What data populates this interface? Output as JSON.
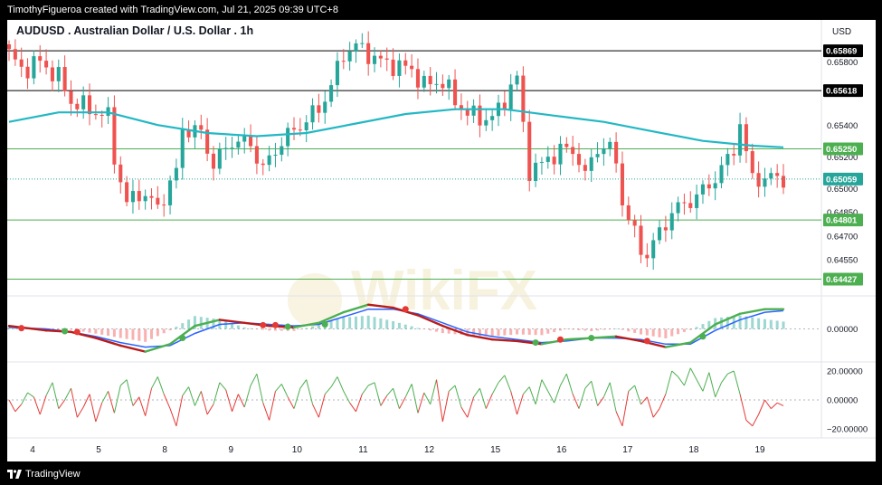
{
  "header": {
    "attribution": "TimothyFigueroa created with TradingView.com, Jul 21, 2025 09:39 UTC+8"
  },
  "footer": {
    "brand": "TradingView"
  },
  "watermark": {
    "text": "WikiFX"
  },
  "chart_data": {
    "type": "candlestick",
    "symbol_title": "AUDUSD . Australian Dollar / U.S. Dollar . 1h",
    "currency": "USD",
    "x_labels": [
      "4",
      "5",
      "8",
      "9",
      "10",
      "11",
      "12",
      "15",
      "16",
      "17",
      "18",
      "19"
    ],
    "price_axis": {
      "ylim": [
        0.6435,
        0.6595
      ],
      "ticks": [
        "0.65800",
        "0.65400",
        "0.65200",
        "0.65000",
        "0.64850",
        "0.64700",
        "0.64550"
      ]
    },
    "horizontal_levels": [
      {
        "value": 0.65869,
        "label": "0.65869",
        "color": "#000000"
      },
      {
        "value": 0.65618,
        "label": "0.65618",
        "color": "#000000"
      },
      {
        "value": 0.6525,
        "label": "0.65250",
        "color": "#4caf50"
      },
      {
        "value": 0.64801,
        "label": "0.64801",
        "color": "#4caf50"
      },
      {
        "value": 0.64427,
        "label": "0.64427",
        "color": "#4caf50"
      }
    ],
    "last_price": {
      "value": 0.65059,
      "label": "0.65059",
      "color": "#26a69a"
    },
    "price_path": [
      {
        "x": 0,
        "y": 0.6585
      },
      {
        "x": 2,
        "y": 0.6575
      },
      {
        "x": 5,
        "y": 0.658
      },
      {
        "x": 8,
        "y": 0.657
      },
      {
        "x": 10,
        "y": 0.6555
      },
      {
        "x": 13,
        "y": 0.655
      },
      {
        "x": 16,
        "y": 0.6545
      },
      {
        "x": 17,
        "y": 0.652
      },
      {
        "x": 19,
        "y": 0.649
      },
      {
        "x": 21,
        "y": 0.6498
      },
      {
        "x": 24,
        "y": 0.6488
      },
      {
        "x": 27,
        "y": 0.651
      },
      {
        "x": 28,
        "y": 0.6538
      },
      {
        "x": 31,
        "y": 0.6535
      },
      {
        "x": 33,
        "y": 0.6515
      },
      {
        "x": 36,
        "y": 0.653
      },
      {
        "x": 39,
        "y": 0.6528
      },
      {
        "x": 41,
        "y": 0.6512
      },
      {
        "x": 44,
        "y": 0.653
      },
      {
        "x": 47,
        "y": 0.654
      },
      {
        "x": 50,
        "y": 0.655
      },
      {
        "x": 52,
        "y": 0.6565
      },
      {
        "x": 54,
        "y": 0.6585
      },
      {
        "x": 56,
        "y": 0.659
      },
      {
        "x": 58,
        "y": 0.6585
      },
      {
        "x": 60,
        "y": 0.658
      },
      {
        "x": 62,
        "y": 0.6578
      },
      {
        "x": 65,
        "y": 0.6575
      },
      {
        "x": 67,
        "y": 0.6565
      },
      {
        "x": 70,
        "y": 0.6568
      },
      {
        "x": 72,
        "y": 0.6555
      },
      {
        "x": 75,
        "y": 0.6545
      },
      {
        "x": 77,
        "y": 0.6544
      },
      {
        "x": 79,
        "y": 0.6548
      },
      {
        "x": 81,
        "y": 0.6565
      },
      {
        "x": 82,
        "y": 0.657
      },
      {
        "x": 83,
        "y": 0.6538
      },
      {
        "x": 84,
        "y": 0.6512
      },
      {
        "x": 86,
        "y": 0.6515
      },
      {
        "x": 88,
        "y": 0.6522
      },
      {
        "x": 90,
        "y": 0.6525
      },
      {
        "x": 92,
        "y": 0.652
      },
      {
        "x": 93,
        "y": 0.6505
      },
      {
        "x": 94,
        "y": 0.652
      },
      {
        "x": 96,
        "y": 0.6528
      },
      {
        "x": 98,
        "y": 0.6518
      },
      {
        "x": 99,
        "y": 0.6492
      },
      {
        "x": 100,
        "y": 0.648
      },
      {
        "x": 102,
        "y": 0.6462
      },
      {
        "x": 103,
        "y": 0.6458
      },
      {
        "x": 105,
        "y": 0.6472
      },
      {
        "x": 107,
        "y": 0.6485
      },
      {
        "x": 109,
        "y": 0.649
      },
      {
        "x": 111,
        "y": 0.6495
      },
      {
        "x": 113,
        "y": 0.6502
      },
      {
        "x": 115,
        "y": 0.6512
      },
      {
        "x": 117,
        "y": 0.6525
      },
      {
        "x": 118,
        "y": 0.6542
      },
      {
        "x": 119,
        "y": 0.652
      },
      {
        "x": 120,
        "y": 0.6508
      },
      {
        "x": 122,
        "y": 0.6505
      },
      {
        "x": 124,
        "y": 0.6508
      },
      {
        "x": 125,
        "y": 0.6506
      }
    ],
    "moving_average": {
      "color": "#22b8c4",
      "points": [
        {
          "x": 0,
          "y": 0.6542
        },
        {
          "x": 8,
          "y": 0.6548
        },
        {
          "x": 16,
          "y": 0.6548
        },
        {
          "x": 24,
          "y": 0.654
        },
        {
          "x": 32,
          "y": 0.6535
        },
        {
          "x": 40,
          "y": 0.6533
        },
        {
          "x": 48,
          "y": 0.6535
        },
        {
          "x": 56,
          "y": 0.6541
        },
        {
          "x": 64,
          "y": 0.6547
        },
        {
          "x": 72,
          "y": 0.655
        },
        {
          "x": 80,
          "y": 0.655
        },
        {
          "x": 88,
          "y": 0.6546
        },
        {
          "x": 96,
          "y": 0.6542
        },
        {
          "x": 104,
          "y": 0.6536
        },
        {
          "x": 112,
          "y": 0.653
        },
        {
          "x": 120,
          "y": 0.6527
        },
        {
          "x": 125,
          "y": 0.6526
        }
      ]
    },
    "macd_panel": {
      "zero_label": "0.00000",
      "macd_line": [
        {
          "x": 0,
          "y": 0.2
        },
        {
          "x": 6,
          "y": -0.1
        },
        {
          "x": 10,
          "y": -0.2
        },
        {
          "x": 14,
          "y": -0.6
        },
        {
          "x": 18,
          "y": -1.1
        },
        {
          "x": 22,
          "y": -1.5
        },
        {
          "x": 26,
          "y": -1.0
        },
        {
          "x": 30,
          "y": 0.2
        },
        {
          "x": 34,
          "y": 0.6
        },
        {
          "x": 38,
          "y": 0.4
        },
        {
          "x": 42,
          "y": 0.2
        },
        {
          "x": 46,
          "y": 0.1
        },
        {
          "x": 50,
          "y": 0.4
        },
        {
          "x": 54,
          "y": 1.1
        },
        {
          "x": 58,
          "y": 1.6
        },
        {
          "x": 62,
          "y": 1.4
        },
        {
          "x": 66,
          "y": 0.9
        },
        {
          "x": 70,
          "y": 0.2
        },
        {
          "x": 74,
          "y": -0.4
        },
        {
          "x": 78,
          "y": -0.7
        },
        {
          "x": 82,
          "y": -0.8
        },
        {
          "x": 86,
          "y": -1.0
        },
        {
          "x": 90,
          "y": -0.7
        },
        {
          "x": 94,
          "y": -0.6
        },
        {
          "x": 98,
          "y": -0.5
        },
        {
          "x": 102,
          "y": -0.8
        },
        {
          "x": 106,
          "y": -1.2
        },
        {
          "x": 110,
          "y": -0.9
        },
        {
          "x": 114,
          "y": 0.3
        },
        {
          "x": 118,
          "y": 1.0
        },
        {
          "x": 122,
          "y": 1.3
        },
        {
          "x": 125,
          "y": 1.3
        }
      ],
      "signal_line": [
        {
          "x": 0,
          "y": 0.1
        },
        {
          "x": 6,
          "y": 0.0
        },
        {
          "x": 10,
          "y": -0.2
        },
        {
          "x": 14,
          "y": -0.5
        },
        {
          "x": 18,
          "y": -0.9
        },
        {
          "x": 22,
          "y": -1.2
        },
        {
          "x": 26,
          "y": -1.1
        },
        {
          "x": 30,
          "y": -0.3
        },
        {
          "x": 34,
          "y": 0.3
        },
        {
          "x": 38,
          "y": 0.4
        },
        {
          "x": 42,
          "y": 0.3
        },
        {
          "x": 46,
          "y": 0.2
        },
        {
          "x": 50,
          "y": 0.3
        },
        {
          "x": 54,
          "y": 0.8
        },
        {
          "x": 58,
          "y": 1.3
        },
        {
          "x": 62,
          "y": 1.3
        },
        {
          "x": 66,
          "y": 1.0
        },
        {
          "x": 70,
          "y": 0.4
        },
        {
          "x": 74,
          "y": -0.2
        },
        {
          "x": 78,
          "y": -0.5
        },
        {
          "x": 82,
          "y": -0.7
        },
        {
          "x": 86,
          "y": -0.9
        },
        {
          "x": 90,
          "y": -0.8
        },
        {
          "x": 94,
          "y": -0.6
        },
        {
          "x": 98,
          "y": -0.6
        },
        {
          "x": 102,
          "y": -0.7
        },
        {
          "x": 106,
          "y": -1.0
        },
        {
          "x": 110,
          "y": -1.0
        },
        {
          "x": 114,
          "y": -0.1
        },
        {
          "x": 118,
          "y": 0.6
        },
        {
          "x": 122,
          "y": 1.1
        },
        {
          "x": 125,
          "y": 1.2
        }
      ],
      "cross_markers": [
        {
          "x": 2,
          "y": 0.05,
          "color": "#e53935"
        },
        {
          "x": 9,
          "y": -0.15,
          "color": "#4caf50"
        },
        {
          "x": 11,
          "y": -0.2,
          "color": "#e53935"
        },
        {
          "x": 28,
          "y": -0.6,
          "color": "#4caf50"
        },
        {
          "x": 41,
          "y": 0.25,
          "color": "#e53935"
        },
        {
          "x": 43,
          "y": 0.25,
          "color": "#e53935"
        },
        {
          "x": 45,
          "y": 0.15,
          "color": "#4caf50"
        },
        {
          "x": 51,
          "y": 0.3,
          "color": "#4caf50"
        },
        {
          "x": 64,
          "y": 1.3,
          "color": "#e53935"
        },
        {
          "x": 85,
          "y": -0.9,
          "color": "#4caf50"
        },
        {
          "x": 89,
          "y": -0.7,
          "color": "#e53935"
        },
        {
          "x": 94,
          "y": -0.6,
          "color": "#4caf50"
        },
        {
          "x": 103,
          "y": -0.8,
          "color": "#e53935"
        },
        {
          "x": 112,
          "y": -0.5,
          "color": "#4caf50"
        }
      ]
    },
    "oscillator_panel": {
      "ticks": [
        "20.00000",
        "0.00000",
        "−20.00000"
      ],
      "ylim": [
        -25,
        25
      ],
      "series": [
        0,
        -8,
        -3,
        5,
        2,
        -10,
        3,
        12,
        -6,
        0,
        8,
        -12,
        -5,
        4,
        -15,
        -2,
        6,
        -9,
        10,
        14,
        -4,
        2,
        -11,
        8,
        16,
        4,
        -6,
        -18,
        3,
        9,
        -4,
        6,
        -10,
        -3,
        12,
        7,
        -8,
        4,
        -5,
        10,
        18,
        -2,
        -14,
        6,
        11,
        2,
        -6,
        8,
        14,
        -3,
        -12,
        4,
        9,
        16,
        6,
        -2,
        -8,
        4,
        10,
        12,
        -4,
        3,
        8,
        -6,
        2,
        11,
        -9,
        5,
        -3,
        14,
        -15,
        6,
        10,
        -5,
        -12,
        2,
        8,
        -6,
        4,
        12,
        17,
        6,
        -10,
        4,
        9,
        -3,
        14,
        6,
        -2,
        10,
        18,
        4,
        -6,
        8,
        13,
        -4,
        2,
        12,
        -8,
        -18,
        6,
        10,
        -3,
        2,
        -12,
        -6,
        4,
        20,
        16,
        10,
        22,
        14,
        6,
        19,
        2,
        12,
        18,
        20,
        4,
        -14,
        -18,
        -10,
        0,
        -6,
        -2,
        -4
      ]
    }
  }
}
